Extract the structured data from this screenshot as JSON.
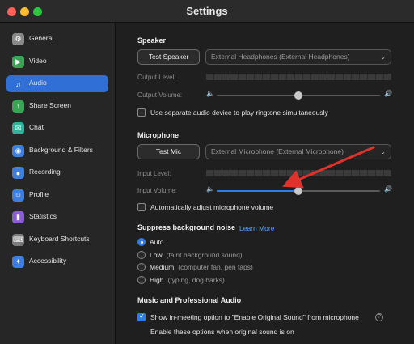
{
  "window": {
    "title": "Settings"
  },
  "sidebar": {
    "items": [
      {
        "label": "General",
        "icon": "gear-icon",
        "color": "#8a8a8a",
        "glyph": "⚙"
      },
      {
        "label": "Video",
        "icon": "video-icon",
        "color": "#3aa655",
        "glyph": "▶"
      },
      {
        "label": "Audio",
        "icon": "headphones-icon",
        "color": "#2f6fd6",
        "glyph": "♫"
      },
      {
        "label": "Share Screen",
        "icon": "share-screen-icon",
        "color": "#3aa655",
        "glyph": "↑"
      },
      {
        "label": "Chat",
        "icon": "chat-icon",
        "color": "#2fb39a",
        "glyph": "✉"
      },
      {
        "label": "Background & Filters",
        "icon": "person-icon",
        "color": "#3d7ee0",
        "glyph": "◉"
      },
      {
        "label": "Recording",
        "icon": "recording-icon",
        "color": "#3d7ee0",
        "glyph": "●"
      },
      {
        "label": "Profile",
        "icon": "profile-icon",
        "color": "#3d7ee0",
        "glyph": "☺"
      },
      {
        "label": "Statistics",
        "icon": "statistics-icon",
        "color": "#8b5ed6",
        "glyph": "▮"
      },
      {
        "label": "Keyboard Shortcuts",
        "icon": "keyboard-icon",
        "color": "#7a7a7a",
        "glyph": "⌨"
      },
      {
        "label": "Accessibility",
        "icon": "accessibility-icon",
        "color": "#3d7ee0",
        "glyph": "✦"
      }
    ],
    "active_index": 2
  },
  "speaker": {
    "title": "Speaker",
    "test_label": "Test Speaker",
    "device": "External Headphones (External Headphones)",
    "output_level_label": "Output Level:",
    "output_volume_label": "Output Volume:",
    "output_volume_level": 0.5,
    "separate_device_label": "Use separate audio device to play ringtone simultaneously",
    "separate_device_checked": false
  },
  "microphone": {
    "title": "Microphone",
    "test_label": "Test Mic",
    "device": "External Microphone (External Microphone)",
    "input_level_label": "Input Level:",
    "input_volume_label": "Input Volume:",
    "input_volume_level": 0.5,
    "auto_adjust_label": "Automatically adjust microphone volume",
    "auto_adjust_checked": false
  },
  "noise": {
    "title": "Suppress background noise",
    "learn_more": "Learn More",
    "options": [
      {
        "label": "Auto",
        "desc": "",
        "checked": true
      },
      {
        "label": "Low",
        "desc": "(faint background sound)",
        "checked": false
      },
      {
        "label": "Medium",
        "desc": "(computer fan, pen taps)",
        "checked": false
      },
      {
        "label": "High",
        "desc": "(typing, dog barks)",
        "checked": false
      }
    ]
  },
  "music": {
    "title": "Music and Professional Audio",
    "original_sound_label": "Show in-meeting option to \"Enable Original Sound\" from microphone",
    "original_sound_checked": true,
    "sub_text": "Enable these options when original sound is on"
  },
  "annotation": {
    "arrow_color": "#e0322a"
  }
}
